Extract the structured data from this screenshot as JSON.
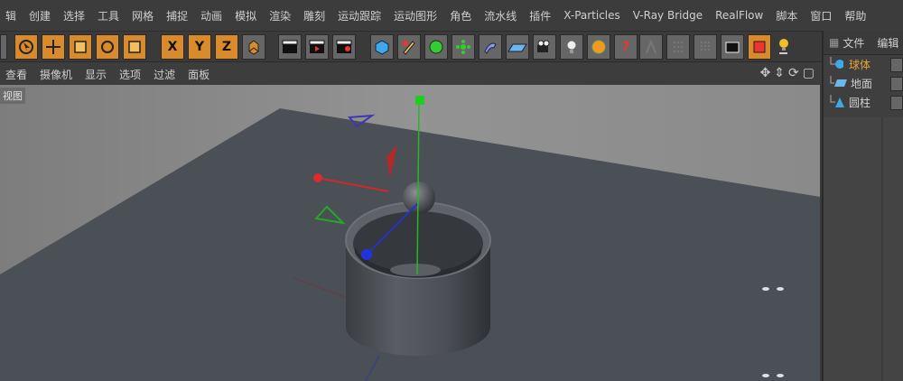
{
  "menu": [
    "辑",
    "创建",
    "选择",
    "工具",
    "网格",
    "捕捉",
    "动画",
    "模拟",
    "渲染",
    "雕刻",
    "运动跟踪",
    "运动图形",
    "角色",
    "流水线",
    "插件",
    "X-Particles",
    "V-Ray Bridge",
    "RealFlow",
    "脚本",
    "窗口",
    "帮助"
  ],
  "toolbar": {
    "axis_x": "X",
    "axis_y": "Y",
    "axis_z": "Z",
    "help": "?"
  },
  "viewport_menu": [
    "查看",
    "摄像机",
    "显示",
    "选项",
    "过滤",
    "面板"
  ],
  "viewport_label": "视图",
  "right_panel": {
    "tabs": [
      "文件",
      "编辑"
    ],
    "objects": [
      {
        "label": "球体",
        "active": true
      },
      {
        "label": "地面",
        "active": false
      },
      {
        "label": "圆柱",
        "active": false
      }
    ]
  },
  "colors": {
    "accent": "#d98a2b",
    "active_text": "#e7a13a",
    "axis_x": "#cc2a2a",
    "axis_y": "#22bb22",
    "axis_z": "#2233cc"
  }
}
